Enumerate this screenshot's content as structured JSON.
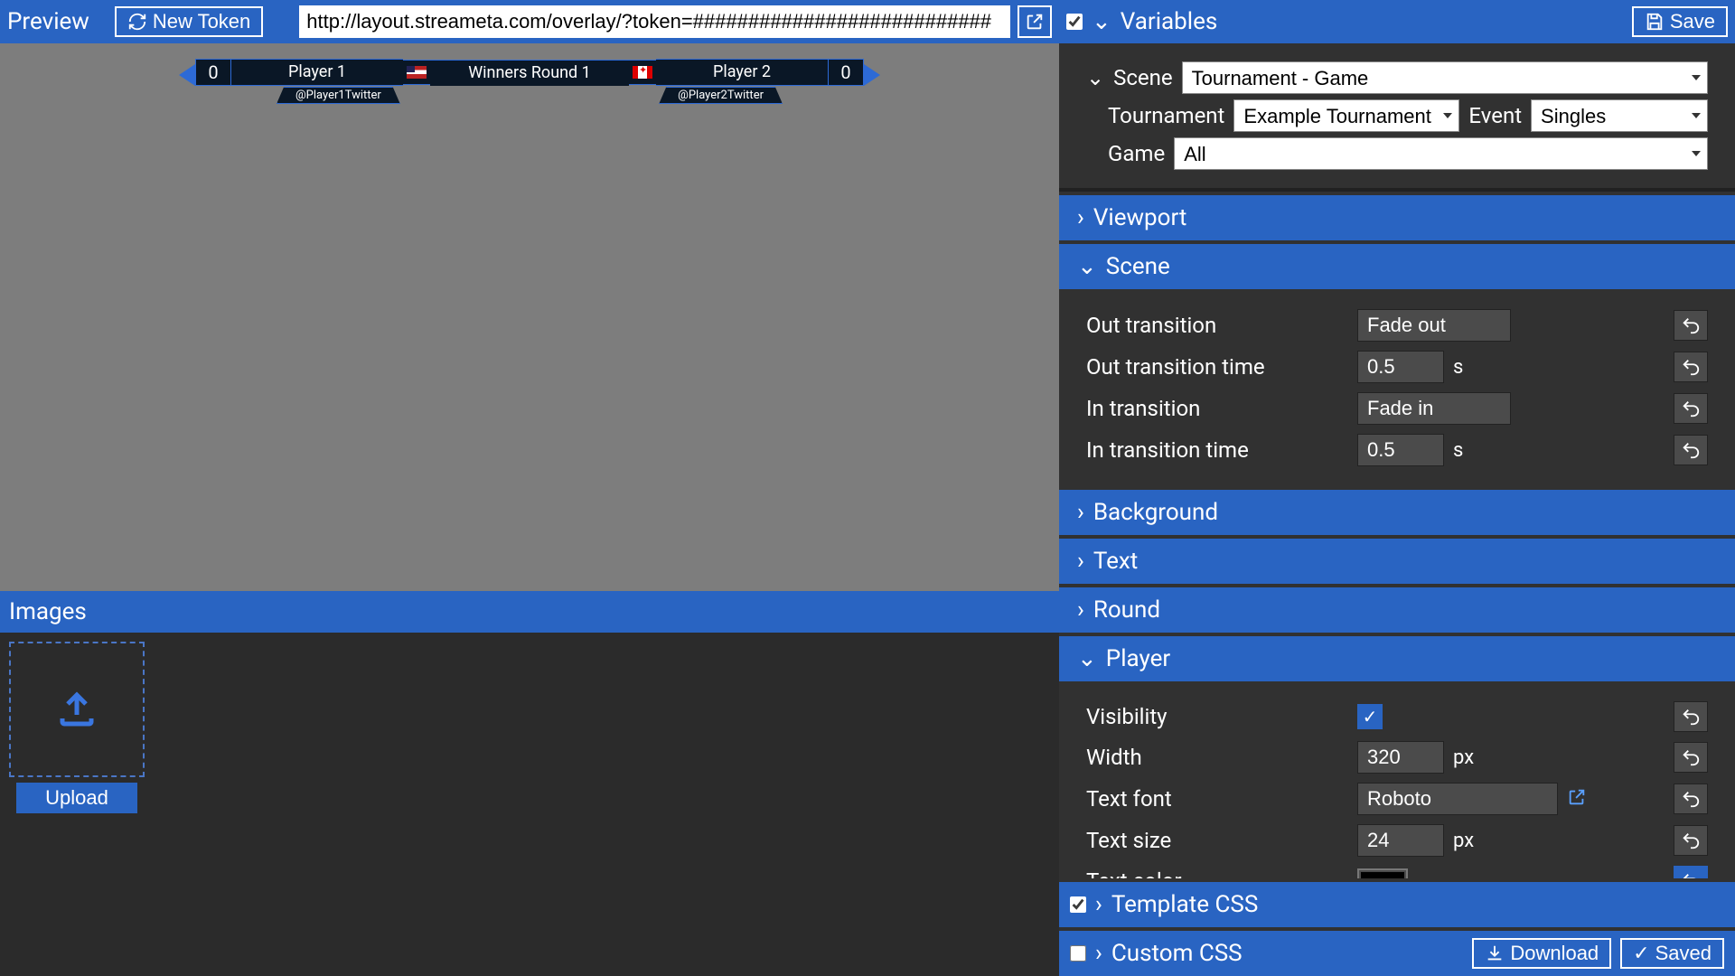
{
  "header": {
    "preview_label": "Preview",
    "new_token_label": "New Token",
    "url": "http://layout.streameta.com/overlay/?token=###########################",
    "variables_label": "Variables",
    "save_label": "Save"
  },
  "scoreboard": {
    "p1_score": "0",
    "p1_name": "Player 1",
    "p1_twitter": "@Player1Twitter",
    "round": "Winners Round 1",
    "p2_name": "Player 2",
    "p2_twitter": "@Player2Twitter",
    "p2_score": "0"
  },
  "images": {
    "title": "Images",
    "upload_label": "Upload"
  },
  "scene_panel": {
    "scene_label": "Scene",
    "scene_value": "Tournament - Game",
    "tournament_label": "Tournament",
    "tournament_value": "Example Tournament",
    "event_label": "Event",
    "event_value": "Singles",
    "game_label": "Game",
    "game_value": "All"
  },
  "sections": {
    "viewport": "Viewport",
    "scene": "Scene",
    "background": "Background",
    "text": "Text",
    "round": "Round",
    "player": "Player"
  },
  "scene_fields": {
    "out_trans_label": "Out transition",
    "out_trans_value": "Fade out",
    "out_time_label": "Out transition time",
    "out_time_value": "0.5",
    "out_time_unit": "s",
    "in_trans_label": "In transition",
    "in_trans_value": "Fade in",
    "in_time_label": "In transition time",
    "in_time_value": "0.5",
    "in_time_unit": "s"
  },
  "player_fields": {
    "visibility_label": "Visibility",
    "width_label": "Width",
    "width_value": "320",
    "width_unit": "px",
    "font_label": "Text font",
    "font_value": "Roboto",
    "size_label": "Text size",
    "size_value": "24",
    "size_unit": "px",
    "color_label": "Text color",
    "color_value": "#000000"
  },
  "footer": {
    "template_css": "Template CSS",
    "custom_css": "Custom CSS",
    "download": "Download",
    "saved": "Saved"
  },
  "glyphs": {
    "chev_down": "⌄",
    "chev_right": "›",
    "check": "✓"
  }
}
